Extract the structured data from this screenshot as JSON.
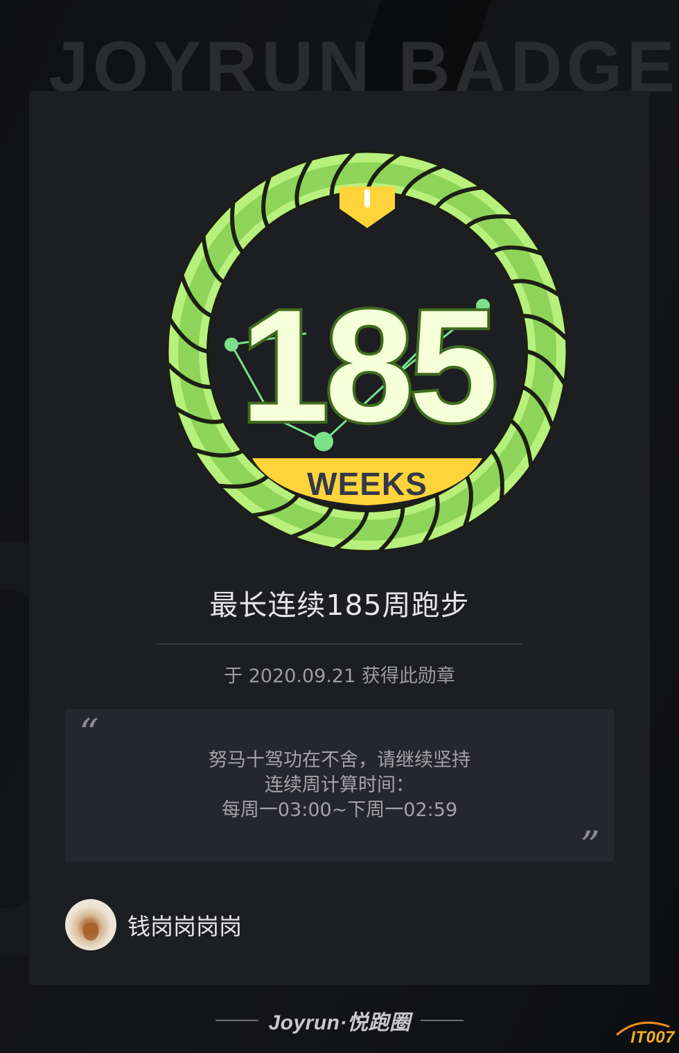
{
  "background": {
    "title": "JOYRUN BADGES"
  },
  "badge": {
    "number": "185",
    "unit": "WEEKS",
    "icon": "streak-badge-icon",
    "colors": {
      "ring_light": "#b7f07c",
      "ring_dark": "#8fd45a",
      "ring_stroke": "#1c1f14",
      "number_fill": "#f5ffd8",
      "number_stroke": "#3f6b1d",
      "ribbon": "#ffd43a",
      "dots": "#7be28a"
    }
  },
  "title": "最长连续185周跑步",
  "earned_text": "于 2020.09.21 获得此勋章",
  "quote": {
    "line1": "努马十驾功在不舍，请继续坚持",
    "line2": "连续周计算时间：",
    "line3": "每周一03:00~下周一02:59"
  },
  "user": {
    "name": "钱岗岗岗岗",
    "avatar_icon": "avatar"
  },
  "footer": {
    "brand": "Joyrun·悦跑圈"
  },
  "watermark": {
    "text": "IT007"
  }
}
